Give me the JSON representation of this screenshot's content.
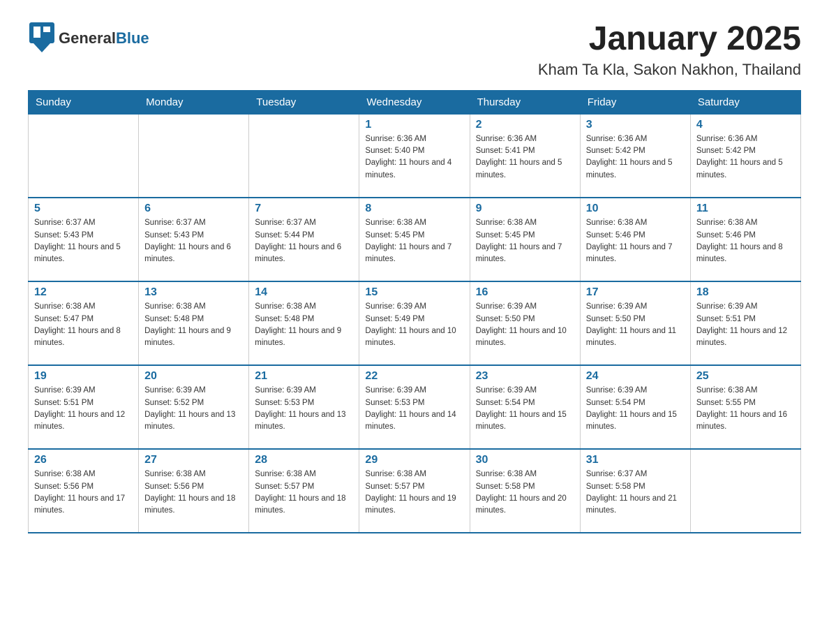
{
  "header": {
    "logo_general": "General",
    "logo_blue": "Blue",
    "month": "January 2025",
    "location": "Kham Ta Kla, Sakon Nakhon, Thailand"
  },
  "days_of_week": [
    "Sunday",
    "Monday",
    "Tuesday",
    "Wednesday",
    "Thursday",
    "Friday",
    "Saturday"
  ],
  "weeks": [
    [
      {
        "day": "",
        "info": ""
      },
      {
        "day": "",
        "info": ""
      },
      {
        "day": "",
        "info": ""
      },
      {
        "day": "1",
        "info": "Sunrise: 6:36 AM\nSunset: 5:40 PM\nDaylight: 11 hours and 4 minutes."
      },
      {
        "day": "2",
        "info": "Sunrise: 6:36 AM\nSunset: 5:41 PM\nDaylight: 11 hours and 5 minutes."
      },
      {
        "day": "3",
        "info": "Sunrise: 6:36 AM\nSunset: 5:42 PM\nDaylight: 11 hours and 5 minutes."
      },
      {
        "day": "4",
        "info": "Sunrise: 6:36 AM\nSunset: 5:42 PM\nDaylight: 11 hours and 5 minutes."
      }
    ],
    [
      {
        "day": "5",
        "info": "Sunrise: 6:37 AM\nSunset: 5:43 PM\nDaylight: 11 hours and 5 minutes."
      },
      {
        "day": "6",
        "info": "Sunrise: 6:37 AM\nSunset: 5:43 PM\nDaylight: 11 hours and 6 minutes."
      },
      {
        "day": "7",
        "info": "Sunrise: 6:37 AM\nSunset: 5:44 PM\nDaylight: 11 hours and 6 minutes."
      },
      {
        "day": "8",
        "info": "Sunrise: 6:38 AM\nSunset: 5:45 PM\nDaylight: 11 hours and 7 minutes."
      },
      {
        "day": "9",
        "info": "Sunrise: 6:38 AM\nSunset: 5:45 PM\nDaylight: 11 hours and 7 minutes."
      },
      {
        "day": "10",
        "info": "Sunrise: 6:38 AM\nSunset: 5:46 PM\nDaylight: 11 hours and 7 minutes."
      },
      {
        "day": "11",
        "info": "Sunrise: 6:38 AM\nSunset: 5:46 PM\nDaylight: 11 hours and 8 minutes."
      }
    ],
    [
      {
        "day": "12",
        "info": "Sunrise: 6:38 AM\nSunset: 5:47 PM\nDaylight: 11 hours and 8 minutes."
      },
      {
        "day": "13",
        "info": "Sunrise: 6:38 AM\nSunset: 5:48 PM\nDaylight: 11 hours and 9 minutes."
      },
      {
        "day": "14",
        "info": "Sunrise: 6:38 AM\nSunset: 5:48 PM\nDaylight: 11 hours and 9 minutes."
      },
      {
        "day": "15",
        "info": "Sunrise: 6:39 AM\nSunset: 5:49 PM\nDaylight: 11 hours and 10 minutes."
      },
      {
        "day": "16",
        "info": "Sunrise: 6:39 AM\nSunset: 5:50 PM\nDaylight: 11 hours and 10 minutes."
      },
      {
        "day": "17",
        "info": "Sunrise: 6:39 AM\nSunset: 5:50 PM\nDaylight: 11 hours and 11 minutes."
      },
      {
        "day": "18",
        "info": "Sunrise: 6:39 AM\nSunset: 5:51 PM\nDaylight: 11 hours and 12 minutes."
      }
    ],
    [
      {
        "day": "19",
        "info": "Sunrise: 6:39 AM\nSunset: 5:51 PM\nDaylight: 11 hours and 12 minutes."
      },
      {
        "day": "20",
        "info": "Sunrise: 6:39 AM\nSunset: 5:52 PM\nDaylight: 11 hours and 13 minutes."
      },
      {
        "day": "21",
        "info": "Sunrise: 6:39 AM\nSunset: 5:53 PM\nDaylight: 11 hours and 13 minutes."
      },
      {
        "day": "22",
        "info": "Sunrise: 6:39 AM\nSunset: 5:53 PM\nDaylight: 11 hours and 14 minutes."
      },
      {
        "day": "23",
        "info": "Sunrise: 6:39 AM\nSunset: 5:54 PM\nDaylight: 11 hours and 15 minutes."
      },
      {
        "day": "24",
        "info": "Sunrise: 6:39 AM\nSunset: 5:54 PM\nDaylight: 11 hours and 15 minutes."
      },
      {
        "day": "25",
        "info": "Sunrise: 6:38 AM\nSunset: 5:55 PM\nDaylight: 11 hours and 16 minutes."
      }
    ],
    [
      {
        "day": "26",
        "info": "Sunrise: 6:38 AM\nSunset: 5:56 PM\nDaylight: 11 hours and 17 minutes."
      },
      {
        "day": "27",
        "info": "Sunrise: 6:38 AM\nSunset: 5:56 PM\nDaylight: 11 hours and 18 minutes."
      },
      {
        "day": "28",
        "info": "Sunrise: 6:38 AM\nSunset: 5:57 PM\nDaylight: 11 hours and 18 minutes."
      },
      {
        "day": "29",
        "info": "Sunrise: 6:38 AM\nSunset: 5:57 PM\nDaylight: 11 hours and 19 minutes."
      },
      {
        "day": "30",
        "info": "Sunrise: 6:38 AM\nSunset: 5:58 PM\nDaylight: 11 hours and 20 minutes."
      },
      {
        "day": "31",
        "info": "Sunrise: 6:37 AM\nSunset: 5:58 PM\nDaylight: 11 hours and 21 minutes."
      },
      {
        "day": "",
        "info": ""
      }
    ]
  ]
}
